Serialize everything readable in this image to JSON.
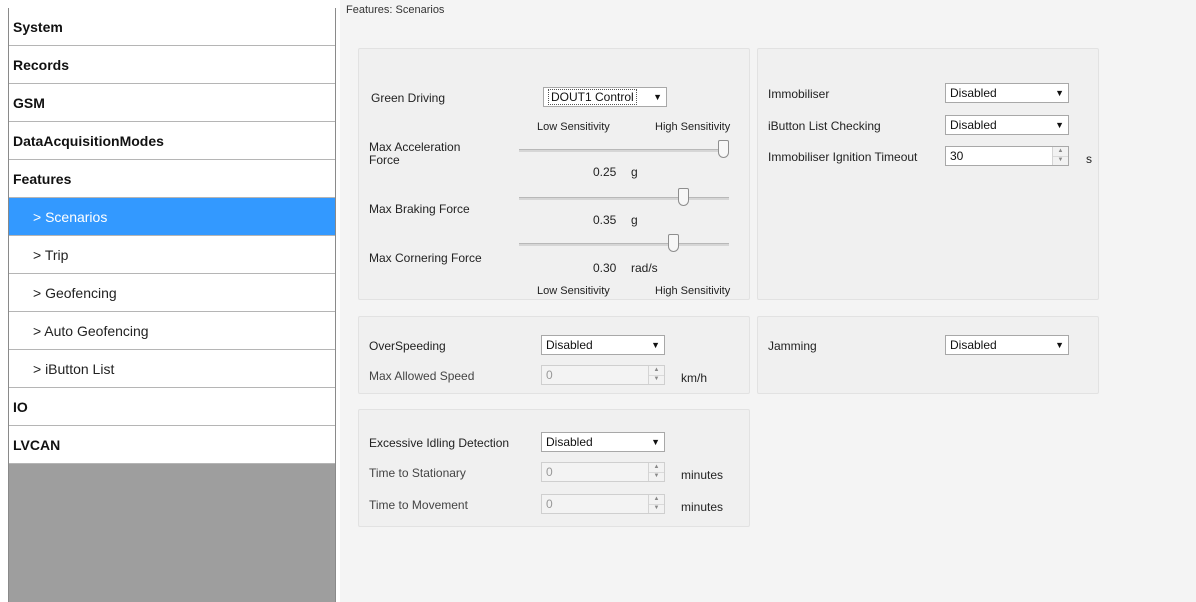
{
  "sidebar": {
    "items": [
      {
        "label": "System"
      },
      {
        "label": "Records"
      },
      {
        "label": "GSM"
      },
      {
        "label": "DataAcquisitionModes"
      },
      {
        "label": "Features"
      },
      {
        "label": "> Scenarios"
      },
      {
        "label": "> Trip"
      },
      {
        "label": "> Geofencing"
      },
      {
        "label": "> Auto Geofencing"
      },
      {
        "label": "> iButton List"
      },
      {
        "label": "IO"
      },
      {
        "label": "LVCAN"
      }
    ]
  },
  "breadcrumb": "Features: Scenarios",
  "green_driving": {
    "label": "Green Driving",
    "value": "DOUT1 Control",
    "low_sensitivity": "Low Sensitivity",
    "high_sensitivity": "High Sensitivity",
    "acceleration": {
      "label": "Max Acceleration Force",
      "value": "0.25",
      "unit": "g",
      "level": 1.0
    },
    "braking": {
      "label": "Max Braking Force",
      "value": "0.35",
      "unit": "g",
      "level": 0.8
    },
    "cornering": {
      "label": "Max Cornering Force",
      "value": "0.30",
      "unit": "rad/s",
      "level": 0.75
    }
  },
  "immobiliser": {
    "label": "Immobiliser",
    "value": "Disabled",
    "ibutton_label": "iButton List Checking",
    "ibutton_value": "Disabled",
    "timeout_label": "Immobiliser Ignition Timeout",
    "timeout_value": "30",
    "timeout_unit": "s"
  },
  "overspeeding": {
    "label": "OverSpeeding",
    "value": "Disabled",
    "speed_label": "Max Allowed Speed",
    "speed_value": "0",
    "speed_unit": "km/h"
  },
  "jamming": {
    "label": "Jamming",
    "value": "Disabled"
  },
  "idling": {
    "label": "Excessive Idling Detection",
    "value": "Disabled",
    "stationary_label": "Time to Stationary",
    "stationary_value": "0",
    "stationary_unit": "minutes",
    "movement_label": "Time to Movement",
    "movement_value": "0",
    "movement_unit": "minutes"
  },
  "colors": {
    "selected": "#3399ff",
    "sidebar_empty": "#9e9e9e"
  }
}
